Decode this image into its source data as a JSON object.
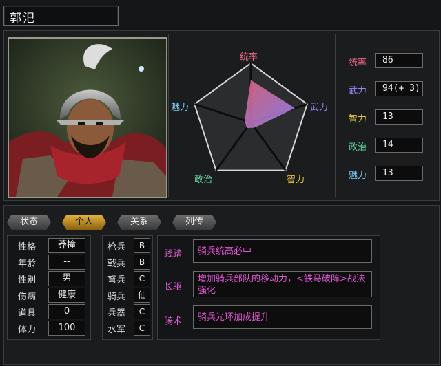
{
  "general": {
    "name": "郭汜"
  },
  "radar": {
    "labels": {
      "top": "统率",
      "right": "武力",
      "bottom_right": "智力",
      "bottom_left": "政治",
      "left": "魅力"
    },
    "values": {
      "统率": 86,
      "武力": 94,
      "智力": 13,
      "政治": 14,
      "魅力": 13
    },
    "max": 120
  },
  "stats": [
    {
      "label": "统率",
      "value": "86",
      "color": "#e86a86"
    },
    {
      "label": "武力",
      "value": "94(+ 3)",
      "color": "#9b86ff"
    },
    {
      "label": "智力",
      "value": "13",
      "color": "#e8c84a"
    },
    {
      "label": "政治",
      "value": "14",
      "color": "#66d8a6"
    },
    {
      "label": "魅力",
      "value": "13",
      "color": "#7ec8f0"
    }
  ],
  "tabs": [
    {
      "label": "状态",
      "active": false
    },
    {
      "label": "个人",
      "active": true
    },
    {
      "label": "关系",
      "active": false
    },
    {
      "label": "列传",
      "active": false
    }
  ],
  "personal": [
    {
      "label": "性格",
      "value": "莽撞"
    },
    {
      "label": "年龄",
      "value": "--"
    },
    {
      "label": "性别",
      "value": "男"
    },
    {
      "label": "伤病",
      "value": "健康"
    },
    {
      "label": "道具",
      "value": "0"
    },
    {
      "label": "体力",
      "value": "100"
    }
  ],
  "troops": [
    {
      "label": "枪兵",
      "grade": "B"
    },
    {
      "label": "戟兵",
      "grade": "B"
    },
    {
      "label": "弩兵",
      "grade": "C"
    },
    {
      "label": "骑兵",
      "grade": "仙"
    },
    {
      "label": "兵器",
      "grade": "C"
    },
    {
      "label": "水军",
      "grade": "C"
    }
  ],
  "skills": [
    {
      "name": "践踏",
      "desc": "骑兵统高必中"
    },
    {
      "name": "长驱",
      "desc": "增加骑兵部队的移动力，<铁马破阵>战法强化"
    },
    {
      "name": "骑术",
      "desc": "骑兵光环加成提升"
    }
  ]
}
